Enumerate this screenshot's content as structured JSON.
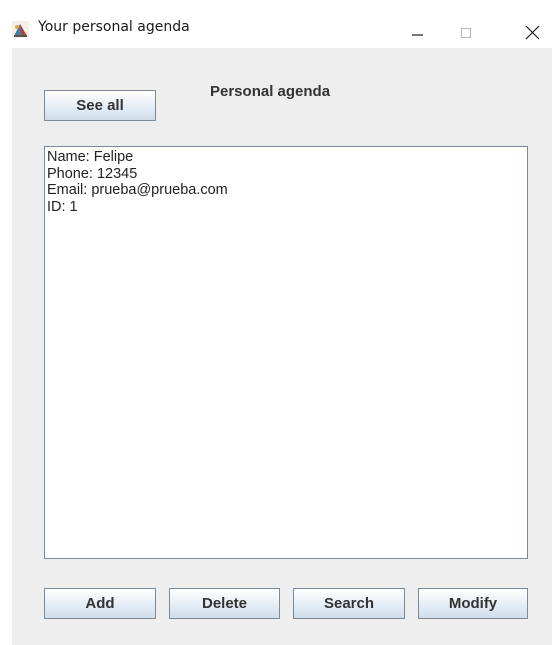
{
  "window": {
    "title": "Your personal agenda"
  },
  "header": {
    "see_all_label": "See all",
    "heading": "Personal agenda"
  },
  "agenda_text": {
    "lines": [
      "Name: Felipe",
      "Phone: 12345",
      "Email: prueba@prueba.com",
      "ID: 1"
    ]
  },
  "actions": {
    "add_label": "Add",
    "delete_label": "Delete",
    "search_label": "Search",
    "modify_label": "Modify"
  },
  "icons": {
    "app": "java-cup-icon",
    "minimize": "minimize-icon",
    "maximize": "maximize-icon",
    "close": "close-icon"
  }
}
